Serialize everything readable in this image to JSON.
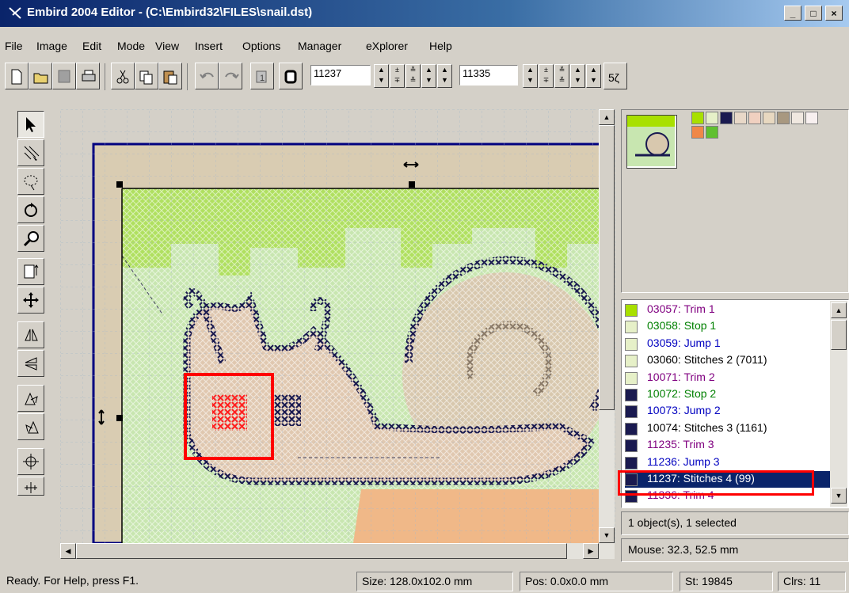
{
  "window": {
    "title": "Embird 2004 Editor - (C:\\Embird32\\FILES\\snail.dst)"
  },
  "menu": [
    "File",
    "Image",
    "Edit",
    "Mode",
    "View",
    "Insert",
    "Options",
    "Manager",
    "eXplorer",
    "Help"
  ],
  "toolbar": {
    "field1": "11237",
    "field2": "11335"
  },
  "thumb": {
    "palette": [
      "#a8e000",
      "#e6f0c8",
      "#1a1a50",
      "#e8d8c8",
      "#f0d0c0",
      "#e8d8c0",
      "#a89880",
      "#f0e8e0",
      "#f8f0f0",
      "#f08848",
      "#60c030"
    ]
  },
  "list": {
    "rows": [
      {
        "label": "03057:  Trim 1",
        "color": "#800080",
        "swatch": "#a8e000"
      },
      {
        "label": "03058:  Stop 1",
        "color": "#008000",
        "swatch": "#e6f0c8"
      },
      {
        "label": "03059:  Jump 1",
        "color": "#0000c0",
        "swatch": "#e6f0c8"
      },
      {
        "label": "03060:  Stitches 2 (7011)",
        "color": "#000000",
        "swatch": "#e6f0c8"
      },
      {
        "label": "10071:  Trim 2",
        "color": "#800080",
        "swatch": "#e6f0c8"
      },
      {
        "label": "10072:  Stop 2",
        "color": "#008000",
        "swatch": "#1a1a50"
      },
      {
        "label": "10073:  Jump 2",
        "color": "#0000c0",
        "swatch": "#1a1a50"
      },
      {
        "label": "10074:  Stitches 3 (1161)",
        "color": "#000000",
        "swatch": "#1a1a50"
      },
      {
        "label": "11235:  Trim 3",
        "color": "#800080",
        "swatch": "#1a1a50"
      },
      {
        "label": "11236:  Jump 3",
        "color": "#0000c0",
        "swatch": "#1a1a50"
      },
      {
        "label": "11237:  Stitches 4 (99)",
        "color": "#ffffff",
        "swatch": "#1a1a50",
        "selected": true
      },
      {
        "label": "11336:  Trim 4",
        "color": "#800080",
        "swatch": "#1a1a50"
      }
    ]
  },
  "info": {
    "objects": "1 object(s), 1 selected",
    "mouse": "Mouse: 32.3, 52.5 mm"
  },
  "status": {
    "ready": "Ready. For Help, press F1.",
    "size": "Size: 128.0x102.0 mm",
    "pos": "Pos: 0.0x0.0 mm",
    "st": "St: 19845",
    "clrs": "Clrs: 11"
  }
}
